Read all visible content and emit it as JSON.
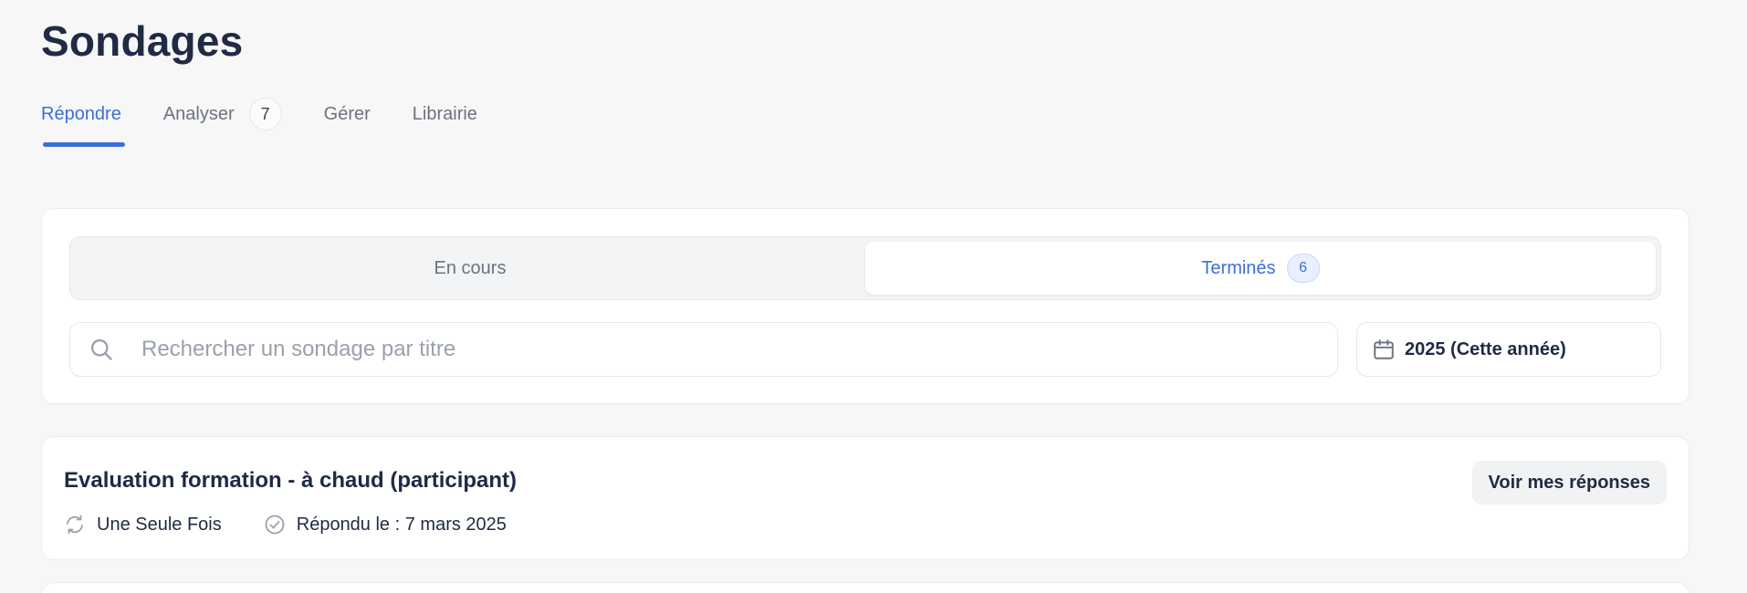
{
  "page": {
    "title": "Sondages"
  },
  "tabs": [
    {
      "label": "Répondre",
      "active": true
    },
    {
      "label": "Analyser",
      "count": "7"
    },
    {
      "label": "Gérer"
    },
    {
      "label": "Librairie"
    }
  ],
  "status_filter": {
    "options": [
      {
        "label": "En cours",
        "active": false
      },
      {
        "label": "Terminés",
        "count": "6",
        "active": true
      }
    ]
  },
  "search": {
    "placeholder": "Rechercher un sondage par titre",
    "value": ""
  },
  "year_filter": {
    "label": "2025 (Cette année)"
  },
  "surveys": [
    {
      "title": "Evaluation formation - à chaud (participant)",
      "frequency": "Une Seule Fois",
      "answered": "Répondu le : 7 mars 2025",
      "action_label": "Voir mes réponses"
    }
  ],
  "colors": {
    "accent": "#3b6ed8",
    "text": "#1f2a44",
    "muted": "#6b7280",
    "background": "#f7f7f8"
  },
  "icons": {
    "search": "search-icon",
    "calendar": "calendar-icon",
    "repeat": "repeat-icon",
    "check": "check-circle-icon"
  }
}
